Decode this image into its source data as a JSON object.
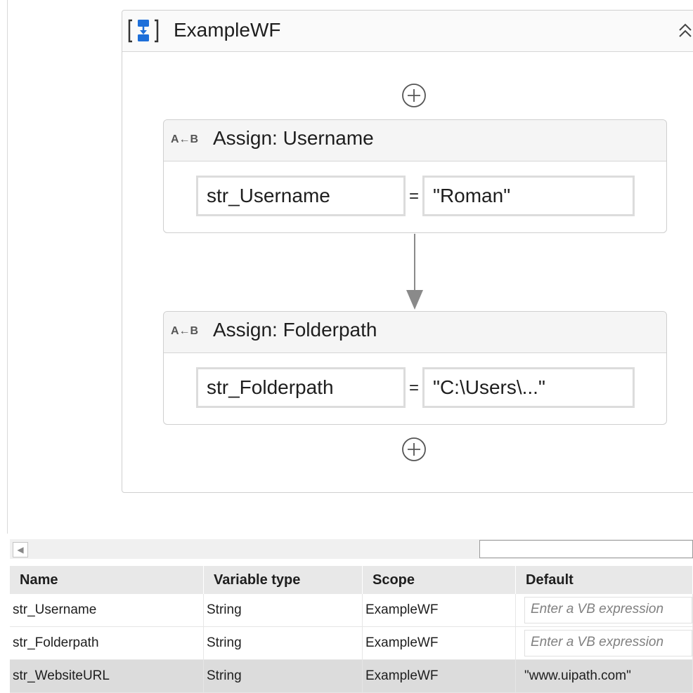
{
  "sequence": {
    "title": "ExampleWF"
  },
  "activities": [
    {
      "type_badge": "A←B",
      "title": "Assign: Username",
      "to": "str_Username",
      "value": "\"Roman\""
    },
    {
      "type_badge": "A←B",
      "title": "Assign: Folderpath",
      "to": "str_Folderpath",
      "value": "\"C:\\Users\\...\""
    }
  ],
  "assign_operator": "=",
  "variables": {
    "columns": [
      "Name",
      "Variable type",
      "Scope",
      "Default"
    ],
    "rows": [
      {
        "name": "str_Username",
        "type": "String",
        "scope": "ExampleWF",
        "default": "",
        "default_placeholder": "Enter a VB expression"
      },
      {
        "name": "str_Folderpath",
        "type": "String",
        "scope": "ExampleWF",
        "default": "",
        "default_placeholder": "Enter a VB expression"
      },
      {
        "name": "str_WebsiteURL",
        "type": "String",
        "scope": "ExampleWF",
        "default": "\"www.uipath.com\"",
        "default_placeholder": ""
      }
    ]
  },
  "icons": {
    "sequence": "sequence-icon",
    "collapse": "double-chevron-up-icon",
    "add": "plus-circle-icon",
    "scroll_left": "scroll-left-arrow-icon"
  },
  "colors": {
    "sequence_icon_blue": "#1e6fd9",
    "connector": "#8a8a8a"
  }
}
